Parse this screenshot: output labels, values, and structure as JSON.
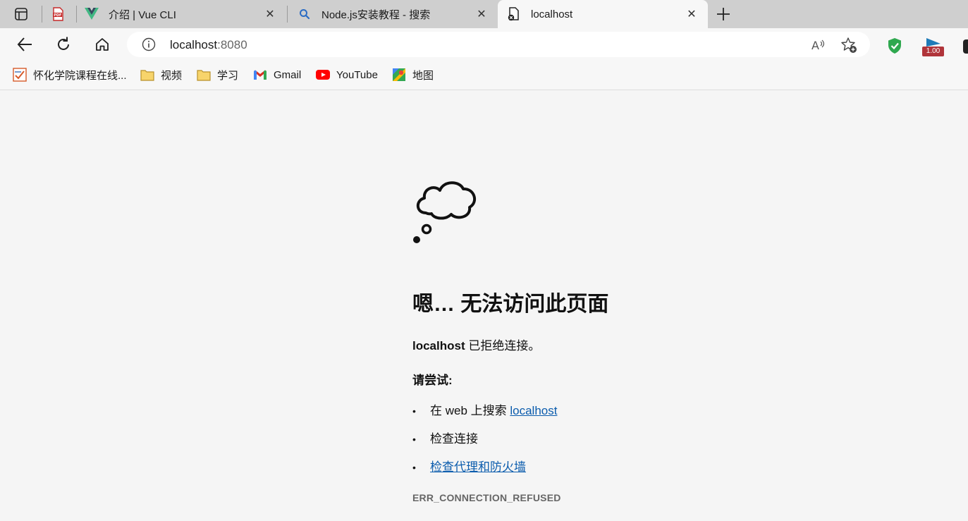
{
  "tabs": [
    {
      "title": "",
      "icon": "pdf-icon"
    },
    {
      "title": "介绍 | Vue CLI",
      "icon": "vue-logo-icon"
    },
    {
      "title": "Node.js安装教程 - 搜索",
      "icon": "search-icon"
    },
    {
      "title": "localhost",
      "icon": "broken-page-icon",
      "active": true
    }
  ],
  "toolbar": {
    "url_host": "localhost",
    "url_port": ":8080",
    "ext_badge": "1.00"
  },
  "bookmarks": [
    {
      "label": "怀化学院课程在线...",
      "icon": "course-site-icon"
    },
    {
      "label": "视频",
      "icon": "folder-icon"
    },
    {
      "label": "学习",
      "icon": "folder-icon"
    },
    {
      "label": "Gmail",
      "icon": "gmail-icon"
    },
    {
      "label": "YouTube",
      "icon": "youtube-icon"
    },
    {
      "label": "地图",
      "icon": "maps-icon"
    }
  ],
  "error_page": {
    "heading": "嗯… 无法访问此页面",
    "host": "localhost",
    "refused_text": " 已拒绝连接。",
    "try_label": "请尝试:",
    "suggestions": {
      "search_prefix": "在 web 上搜索 ",
      "search_link": "localhost",
      "check_connection": "检查连接",
      "check_proxy": "检查代理和防火墙"
    },
    "bullet": "•",
    "error_code": "ERR_CONNECTION_REFUSED"
  },
  "colors": {
    "link": "#0b5cad",
    "tabstrip": "#cfcfcf",
    "page_bg": "#f5f5f5"
  }
}
